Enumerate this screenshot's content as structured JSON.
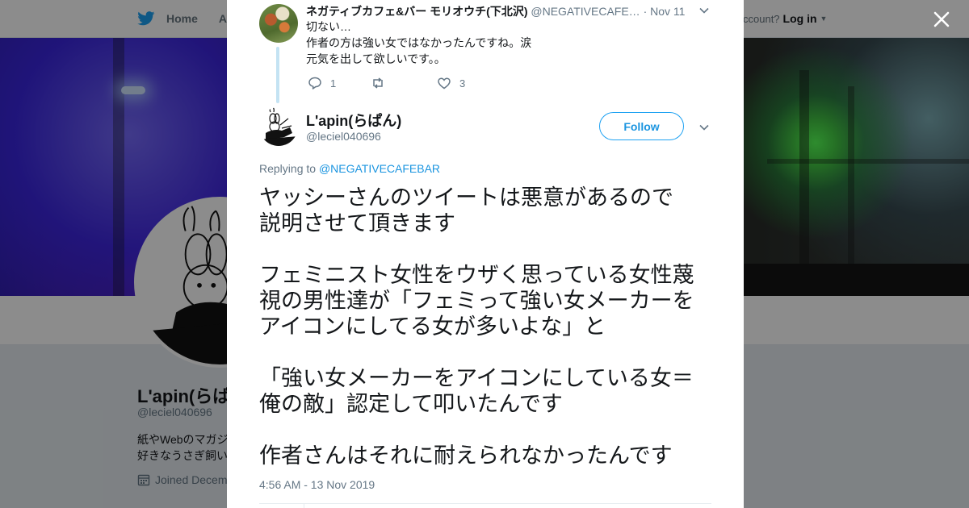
{
  "topbar": {
    "home_label": "Home",
    "about_label": "Abo",
    "account_prompt": "ccount?",
    "login_label": "Log in"
  },
  "profile": {
    "name": "L'apin(らぱ",
    "handle": "@leciel040696",
    "bio_line1": "紙やWebのマガジ",
    "bio_line2": "好きなうさぎ飼い",
    "joined": "Joined Decem"
  },
  "parent_tweet": {
    "author_name": "ネガティブカフェ&バー モリオウチ(下北沢)",
    "author_handle": "@NEGATIVECAFE…",
    "date": "· Nov 11",
    "text_line1": "切ない…",
    "text_line2": "作者の方は強い女ではなかったんですね。涙",
    "text_line3": "元気を出して欲しいです。。",
    "reply_count": "1",
    "retweet_count": "",
    "like_count": "3"
  },
  "tweet": {
    "author_name": "L'apin(らぱん)",
    "author_handle": "@leciel040696",
    "follow_label": "Follow",
    "replying_prefix": "Replying to",
    "replying_mention": "@NEGATIVECAFEBAR",
    "body_lines": [
      "ヤッシーさんのツイートは悪意があるので",
      "説明させて頂きます",
      "フェミニスト女性をウザく思っている女性蔑",
      "視の男性達が「フェミって強い女メーカーを",
      "アイコンにしてる女が多いよな」と",
      "「強い女メーカーをアイコンにしている女＝",
      "俺の敵」認定して叩いたんです",
      "作者さんはそれに耐えられなかったんです"
    ],
    "timestamp": "4:56 AM - 13 Nov 2019"
  },
  "icons": [
    "twitter-bird-icon",
    "close-icon",
    "chevron-down-icon",
    "reply-icon",
    "retweet-icon",
    "like-icon",
    "calendar-icon"
  ],
  "colors": {
    "accent": "#1da1f2",
    "link": "#1b95e0",
    "text": "#14171a",
    "secondary_text": "#657786",
    "thread_line": "#c4e3f3"
  }
}
